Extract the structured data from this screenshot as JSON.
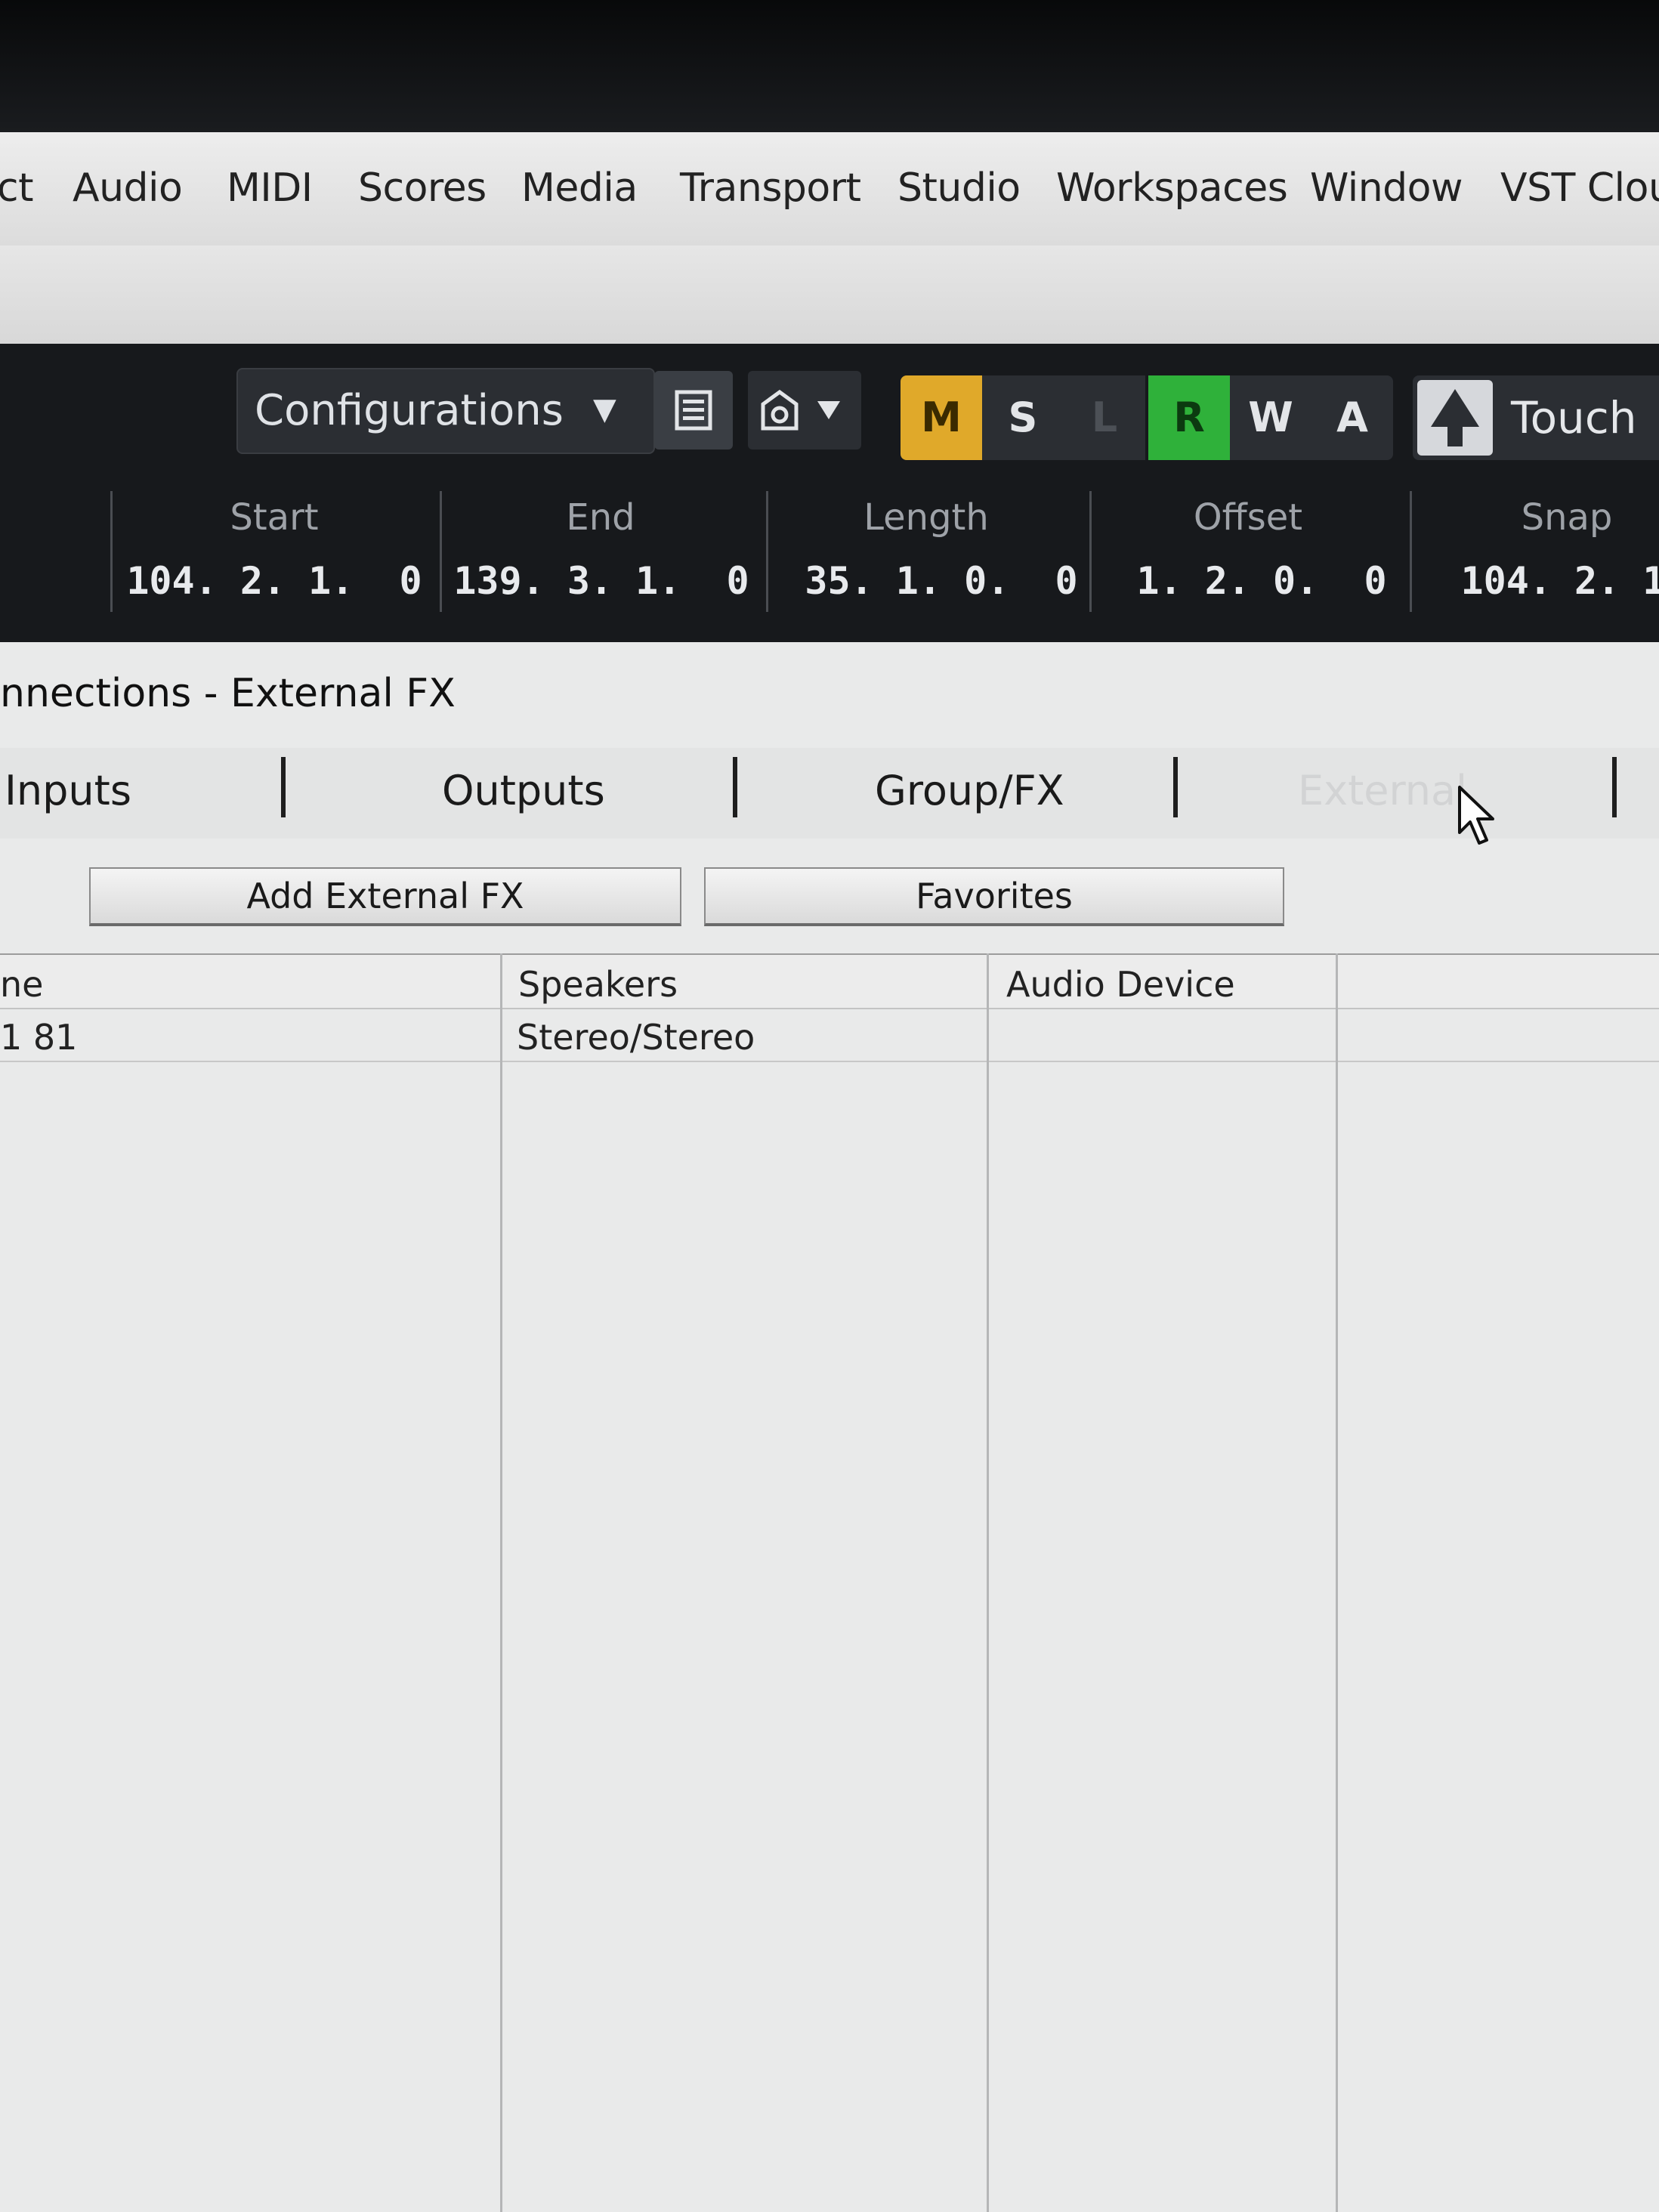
{
  "menubar": {
    "items": [
      "ct",
      "Audio",
      "MIDI",
      "Scores",
      "Media",
      "Transport",
      "Studio",
      "Workspaces",
      "Window",
      "VST Clou"
    ]
  },
  "toolbar": {
    "configurations_label": "Configurations",
    "mode_buttons": [
      {
        "label": "M",
        "color": "#e0a92a",
        "text_color": "#3a2a00"
      },
      {
        "label": "S",
        "color": "#2b2e33",
        "text_color": "#e3e5e8"
      },
      {
        "label": "L",
        "color": "#2b2e33",
        "text_color": "#4c5056"
      },
      {
        "label": "R",
        "color": "#2fb13a",
        "text_color": "#0c3a10"
      },
      {
        "label": "W",
        "color": "#2b2e33",
        "text_color": "#e3e5e8"
      },
      {
        "label": "A",
        "color": "#2b2e33",
        "text_color": "#e3e5e8"
      }
    ],
    "automation_mode": "Touch"
  },
  "info_line": {
    "fields": [
      {
        "label": "Start",
        "value": "104. 2. 1.  0"
      },
      {
        "label": "End",
        "value": "139. 3. 1.  0"
      },
      {
        "label": "Length",
        "value": "35. 1. 0.  0"
      },
      {
        "label": "Offset",
        "value": "1. 2. 0.  0"
      },
      {
        "label": "Snap",
        "value": "104. 2. 1."
      }
    ]
  },
  "panel": {
    "title": "nnections - External FX",
    "tabs": [
      "Inputs",
      "Outputs",
      "Group/FX",
      "External"
    ],
    "buttons": {
      "add": "Add External FX",
      "favorites": "Favorites"
    },
    "table": {
      "headers": [
        "ne",
        "Speakers",
        "Audio Device",
        ""
      ],
      "rows": [
        [
          "1 81",
          "Stereo/Stereo",
          "",
          ""
        ]
      ]
    }
  }
}
